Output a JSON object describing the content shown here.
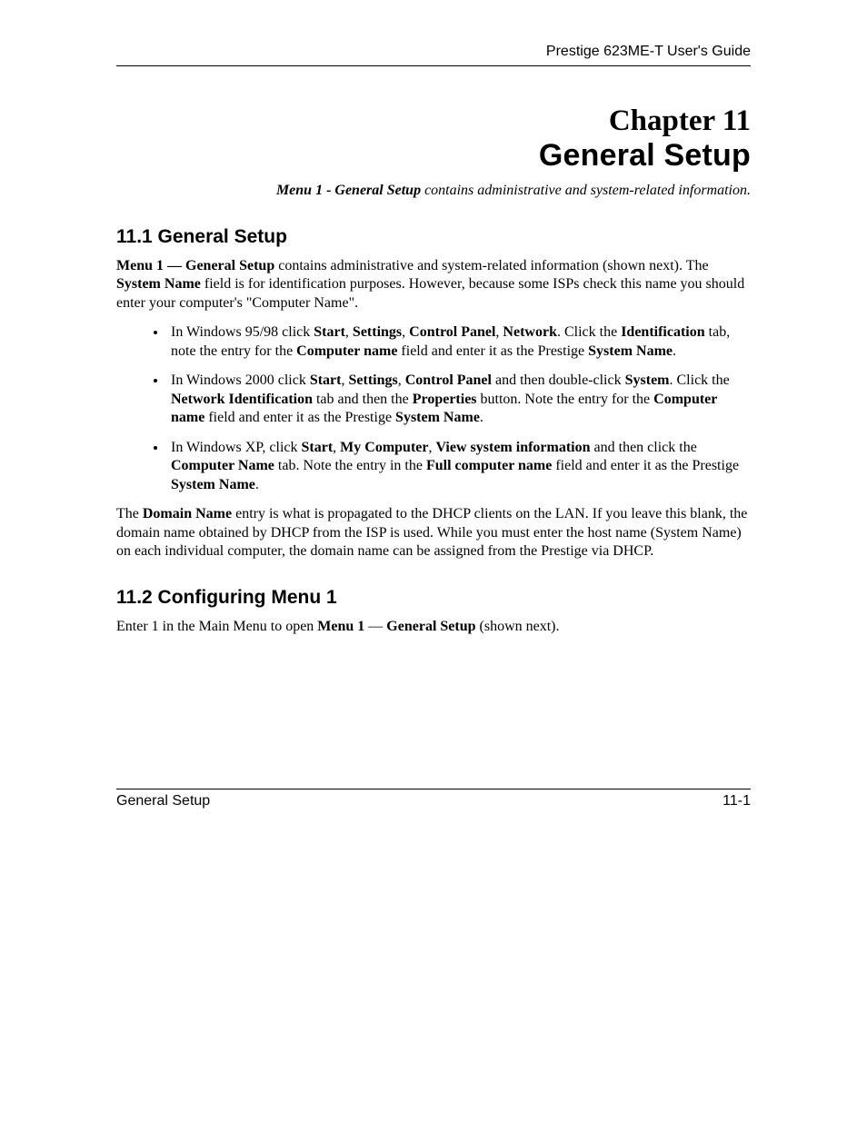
{
  "header": {
    "running_head": "Prestige 623ME-T User's Guide"
  },
  "chapter": {
    "line1": "Chapter 11",
    "line2": "General Setup",
    "subtitle_bold": "Menu 1 - General Setup",
    "subtitle_rest": " contains administrative and system-related information."
  },
  "section_11_1": {
    "heading": "11.1  General Setup",
    "para1_runs": [
      {
        "t": "Menu 1 — General Setup",
        "b": true
      },
      {
        "t": " contains administrative and system-related information (shown next). The "
      },
      {
        "t": "System Name",
        "b": true
      },
      {
        "t": " field is for identification purposes. However, because some ISPs check this name you should enter your computer's  \"Computer Name\"."
      }
    ],
    "bullets": [
      [
        {
          "t": "In Windows 95/98 click "
        },
        {
          "t": "Start",
          "b": true
        },
        {
          "t": ", "
        },
        {
          "t": "Settings",
          "b": true
        },
        {
          "t": ", "
        },
        {
          "t": "Control Panel",
          "b": true
        },
        {
          "t": ", "
        },
        {
          "t": "Network",
          "b": true
        },
        {
          "t": ". Click the "
        },
        {
          "t": "Identification",
          "b": true
        },
        {
          "t": " tab, note the entry for the "
        },
        {
          "t": "Computer name",
          "b": true
        },
        {
          "t": " field and enter it as the Prestige "
        },
        {
          "t": "System Name",
          "b": true
        },
        {
          "t": "."
        }
      ],
      [
        {
          "t": "In Windows 2000 click "
        },
        {
          "t": "Start",
          "b": true
        },
        {
          "t": ", "
        },
        {
          "t": "Settings",
          "b": true
        },
        {
          "t": ", "
        },
        {
          "t": "Control Panel",
          "b": true
        },
        {
          "t": " and then double-click "
        },
        {
          "t": "System",
          "b": true
        },
        {
          "t": ". Click the "
        },
        {
          "t": "Network Identification",
          "b": true
        },
        {
          "t": " tab and then the "
        },
        {
          "t": "Properties",
          "b": true
        },
        {
          "t": " button. Note the entry for the "
        },
        {
          "t": "Computer name",
          "b": true
        },
        {
          "t": " field and enter it as the Prestige "
        },
        {
          "t": "System Name",
          "b": true
        },
        {
          "t": "."
        }
      ],
      [
        {
          "t": "In Windows XP, click "
        },
        {
          "t": "Start",
          "b": true
        },
        {
          "t": ", "
        },
        {
          "t": "My Computer",
          "b": true
        },
        {
          "t": ", "
        },
        {
          "t": "View system information",
          "b": true
        },
        {
          "t": " and then click the "
        },
        {
          "t": "Computer Name",
          "b": true
        },
        {
          "t": " tab. Note the entry in the "
        },
        {
          "t": "Full computer name",
          "b": true
        },
        {
          "t": " field and enter it as the Prestige "
        },
        {
          "t": "System Name",
          "b": true
        },
        {
          "t": "."
        }
      ]
    ],
    "para2_runs": [
      {
        "t": "The "
      },
      {
        "t": "Domain Name",
        "b": true
      },
      {
        "t": " entry is what is propagated to the DHCP clients on the LAN. If you leave this blank, the domain name obtained by DHCP from the ISP is used. While you must enter the host name (System Name) on each individual computer, the domain name can be assigned from the Prestige via DHCP."
      }
    ]
  },
  "section_11_2": {
    "heading": "11.2  Configuring Menu 1",
    "para_runs": [
      {
        "t": "Enter 1 in the Main Menu to open "
      },
      {
        "t": "Menu 1",
        "b": true
      },
      {
        "t": " — "
      },
      {
        "t": "General Setup",
        "b": true
      },
      {
        "t": " (shown next)."
      }
    ]
  },
  "footer": {
    "left": "General Setup",
    "right": "11-1"
  }
}
